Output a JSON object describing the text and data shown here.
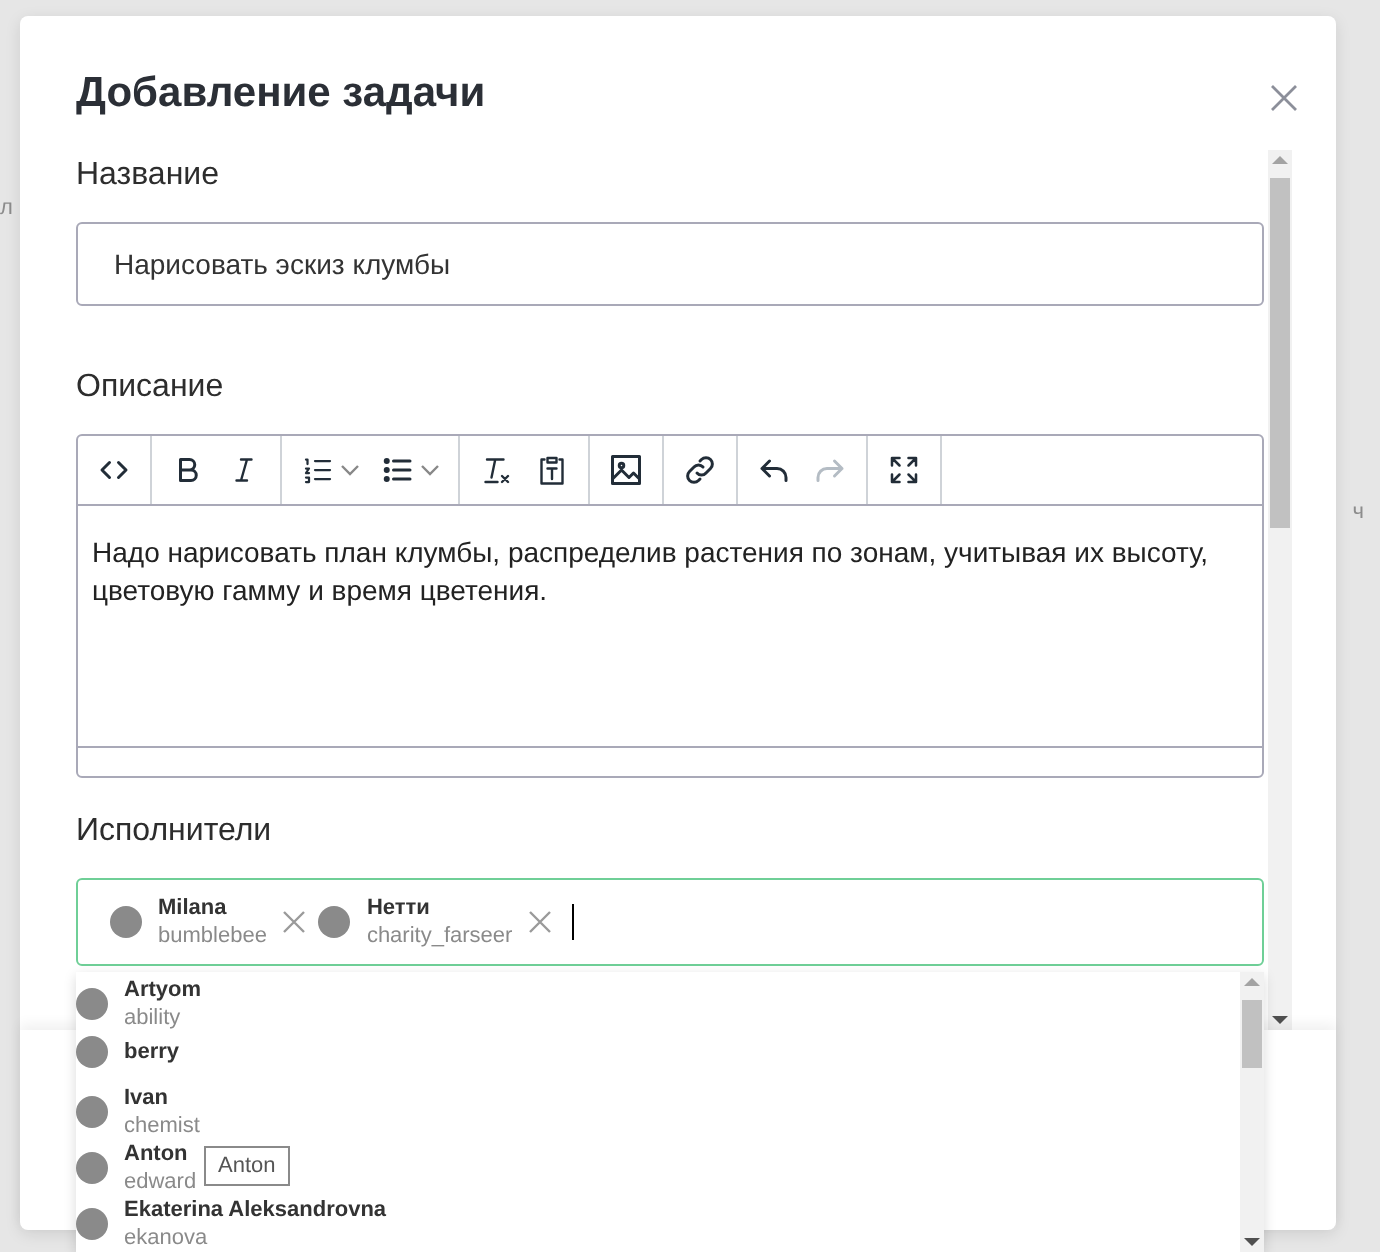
{
  "backdrop": {
    "fragments": [
      "л",
      "ч"
    ]
  },
  "dialog": {
    "title": "Добавление задачи",
    "name_field": {
      "label": "Название",
      "value": "Нарисовать эскиз клумбы"
    },
    "description": {
      "label": "Описание",
      "toolbar": [
        [
          {
            "kind": "code",
            "disabled": false,
            "dropdown": false
          }
        ],
        [
          {
            "kind": "bold",
            "disabled": false,
            "dropdown": false
          },
          {
            "kind": "italic",
            "disabled": false,
            "dropdown": false
          }
        ],
        [
          {
            "kind": "ordered-list",
            "disabled": false,
            "dropdown": true
          },
          {
            "kind": "bullet-list",
            "disabled": false,
            "dropdown": true
          }
        ],
        [
          {
            "kind": "clear-format",
            "disabled": false,
            "dropdown": false
          },
          {
            "kind": "paste-text",
            "disabled": false,
            "dropdown": false
          }
        ],
        [
          {
            "kind": "image",
            "disabled": false,
            "dropdown": false
          }
        ],
        [
          {
            "kind": "link",
            "disabled": false,
            "dropdown": false
          }
        ],
        [
          {
            "kind": "undo",
            "disabled": false,
            "dropdown": false
          },
          {
            "kind": "redo",
            "disabled": true,
            "dropdown": false
          }
        ],
        [
          {
            "kind": "fullscreen",
            "disabled": false,
            "dropdown": false
          }
        ]
      ],
      "text": "Надо нарисовать план клумбы, распределив растения по зонам, учитывая их высоту, цветовую гамму и время цветения."
    },
    "assignees": {
      "label": "Исполнители",
      "selected": [
        {
          "name": "Milana",
          "username": "bumblebee"
        },
        {
          "name": "Нетти",
          "username": "charity_farseer"
        }
      ],
      "options": [
        {
          "name": "Artyom",
          "username": "ability"
        },
        {
          "name": "berry"
        },
        {
          "name": "Ivan",
          "username": "chemist"
        },
        {
          "name": "Anton",
          "username": "edward"
        },
        {
          "name": "Ekaterina Aleksandrovna",
          "username": "ekanova"
        }
      ],
      "tooltip": "Anton"
    }
  }
}
